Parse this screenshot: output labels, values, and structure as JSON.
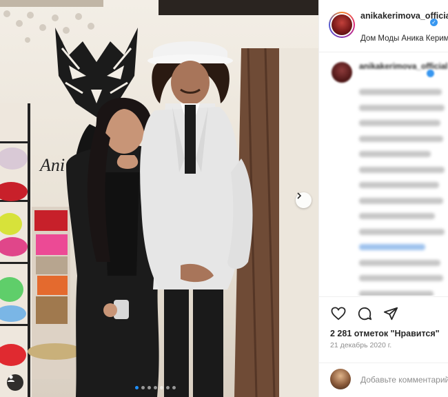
{
  "header": {
    "username": "anikakerimova_official",
    "location": "Дом Моды Аника Керимова",
    "avatar_icon": "profile-photo"
  },
  "caption": {
    "username": "anikakerimova_official",
    "text_blurred": true
  },
  "photo": {
    "logo_text": "Ani",
    "carousel_count": 7,
    "carousel_active": 0
  },
  "actions": {
    "like_icon": "heart-icon",
    "comment_icon": "comment-bubble-icon",
    "share_icon": "paper-plane-icon",
    "likes_text": "2 281 отметок \"Нравится\"",
    "date_text": "21 декабрь 2020 г."
  },
  "comment": {
    "placeholder": "Добавьте комментарий..."
  },
  "colors": {
    "accent_blue": "#3897f0",
    "text": "#262626",
    "muted": "#8e8e8e",
    "border": "#efefef"
  }
}
